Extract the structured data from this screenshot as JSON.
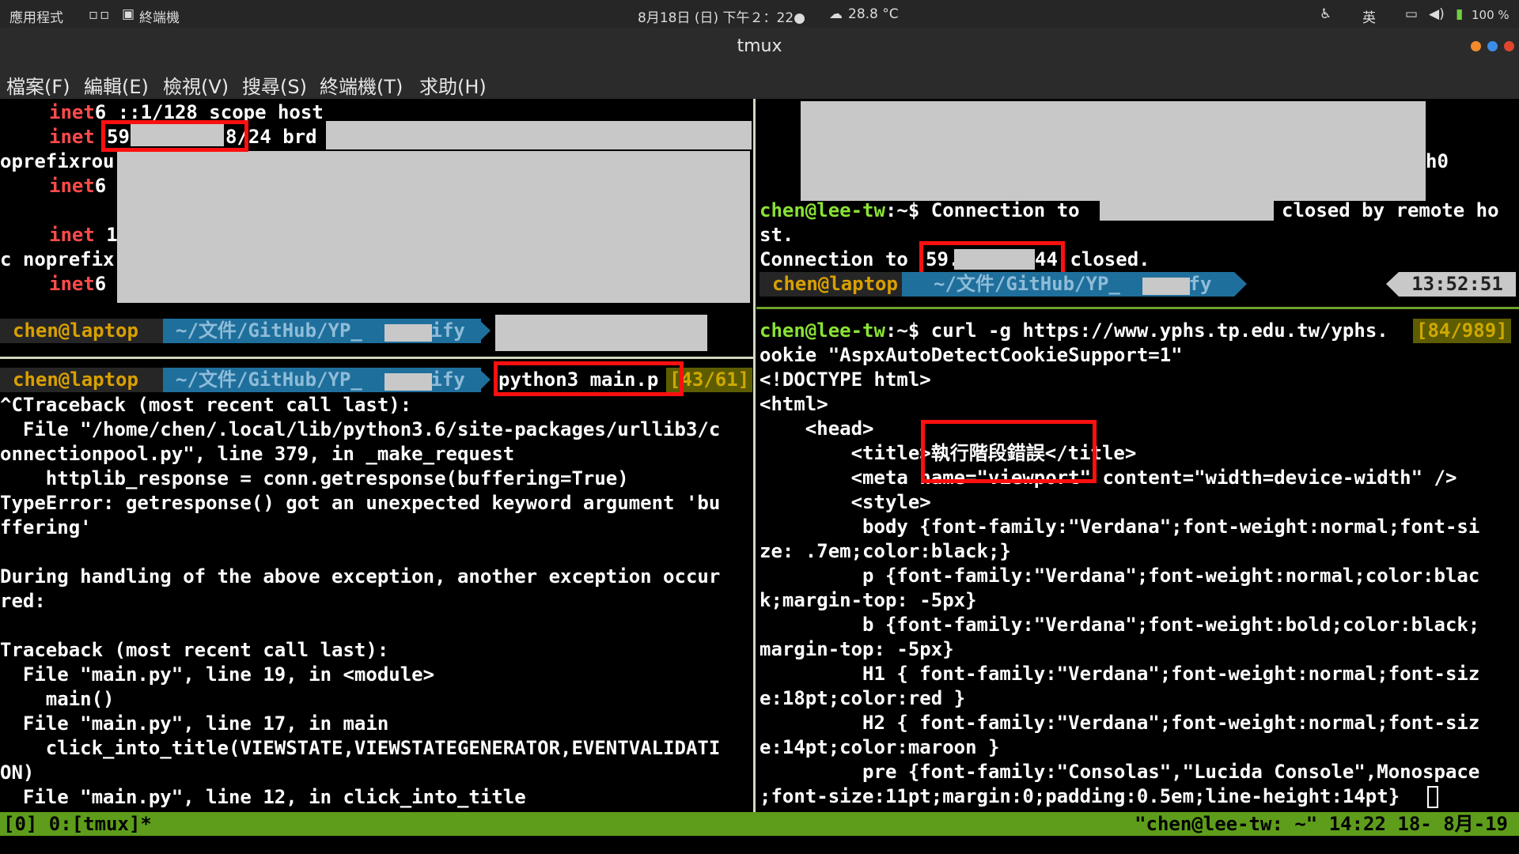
{
  "topbar": {
    "apps": "應用程式",
    "app_name": "終端機",
    "datetime": "8月18日 (日) 下午２：22●",
    "weather": "28.8 °C",
    "ime": "英",
    "battery": "100 %"
  },
  "window": {
    "title": "tmux"
  },
  "menu": [
    "檔案(F)",
    "編輯(E)",
    "檢視(V)",
    "搜尋(S)",
    "終端機(T)",
    "求助(H)"
  ],
  "left_top": {
    "l1a": "inet",
    "l1b": "6 ::1/128 scope host",
    "l2a": "inet",
    "l2b": "59",
    "l2c": "8/24 brd",
    "l3": "oprefixrou",
    "l4": "inet",
    "l4b": "6",
    "l5": "inet",
    "l5b": " 1",
    "l6": "c noprefix",
    "l7": "inet",
    "l7b": "6"
  },
  "left_prompt1": {
    "user": "chen@laptop",
    "path": "~/文件/GitHub/YP_      ify"
  },
  "left_prompt2": {
    "user": "chen@laptop",
    "path": "~/文件/GitHub/YP_      ify",
    "cmd": "python3 main.p",
    "counter": "[43/61]"
  },
  "left_output": [
    "^CTraceback (most recent call last):",
    "  File \"/home/chen/.local/lib/python3.6/site-packages/urllib3/c",
    "onnectionpool.py\", line 379, in _make_request",
    "    httplib_response = conn.getresponse(buffering=True)",
    "TypeError: getresponse() got an unexpected keyword argument 'bu",
    "ffering'",
    "",
    "During handling of the above exception, another exception occur",
    "red:",
    "",
    "Traceback (most recent call last):",
    "  File \"main.py\", line 19, in <module>",
    "    main()",
    "  File \"main.py\", line 17, in main",
    "    click_into_title(VIEWSTATE,VIEWSTATEGENERATOR,EVENTVALIDATI",
    "ON)",
    "  File \"main.py\", line 12, in click_into_title"
  ],
  "right_top": {
    "h0": "h0",
    "prompt_user": "chen@lee-tw",
    "prompt_sep": ":~$ ",
    "conn1a": "Connection to",
    "conn1b": "closed by remote ho",
    "conn1c": "st.",
    "conn2a": "Connection to ",
    "conn2b": "59.",
    "conn2c": "44",
    "conn2d": " closed.",
    "pl_user": "chen@laptop",
    "pl_path": "~/文件/GitHub/YP_      fy",
    "time": "13:52:51"
  },
  "right_bottom": {
    "prompt_user": "chen@lee-tw",
    "prompt_sep": ":~$ ",
    "cmd": "curl -g https://www.yphs.tp.edu.tw/yphs.",
    "counter": "[84/989]",
    "lines": [
      "ookie \"AspxAutoDetectCookieSupport=1\"",
      "<!DOCTYPE html>",
      "<html>",
      "    <head>",
      "        <title>執行階段錯誤</title>",
      "        <meta name=\"viewport\" content=\"width=device-width\" />",
      "        <style>",
      "         body {font-family:\"Verdana\";font-weight:normal;font-si",
      "ze: .7em;color:black;}",
      "         p {font-family:\"Verdana\";font-weight:normal;color:blac",
      "k;margin-top: -5px}",
      "         b {font-family:\"Verdana\";font-weight:bold;color:black;",
      "margin-top: -5px}",
      "         H1 { font-family:\"Verdana\";font-weight:normal;font-siz",
      "e:18pt;color:red }",
      "         H2 { font-family:\"Verdana\";font-weight:normal;font-siz",
      "e:14pt;color:maroon }",
      "         pre {font-family:\"Consolas\",\"Lucida Console\",Monospace",
      ";font-size:11pt;margin:0;padding:0.5em;line-height:14pt}"
    ]
  },
  "status": {
    "left": "[0] 0:[tmux]*",
    "right": "\"chen@lee-tw: ~\" 14:22 18- 8月-19"
  },
  "colors": {
    "red_prompt": "#ff4b4b",
    "green_user": "#8ae234",
    "blue_path": "#729fcf",
    "status_bar": "#5e9d1b",
    "highlight_box": "#ff1010"
  }
}
